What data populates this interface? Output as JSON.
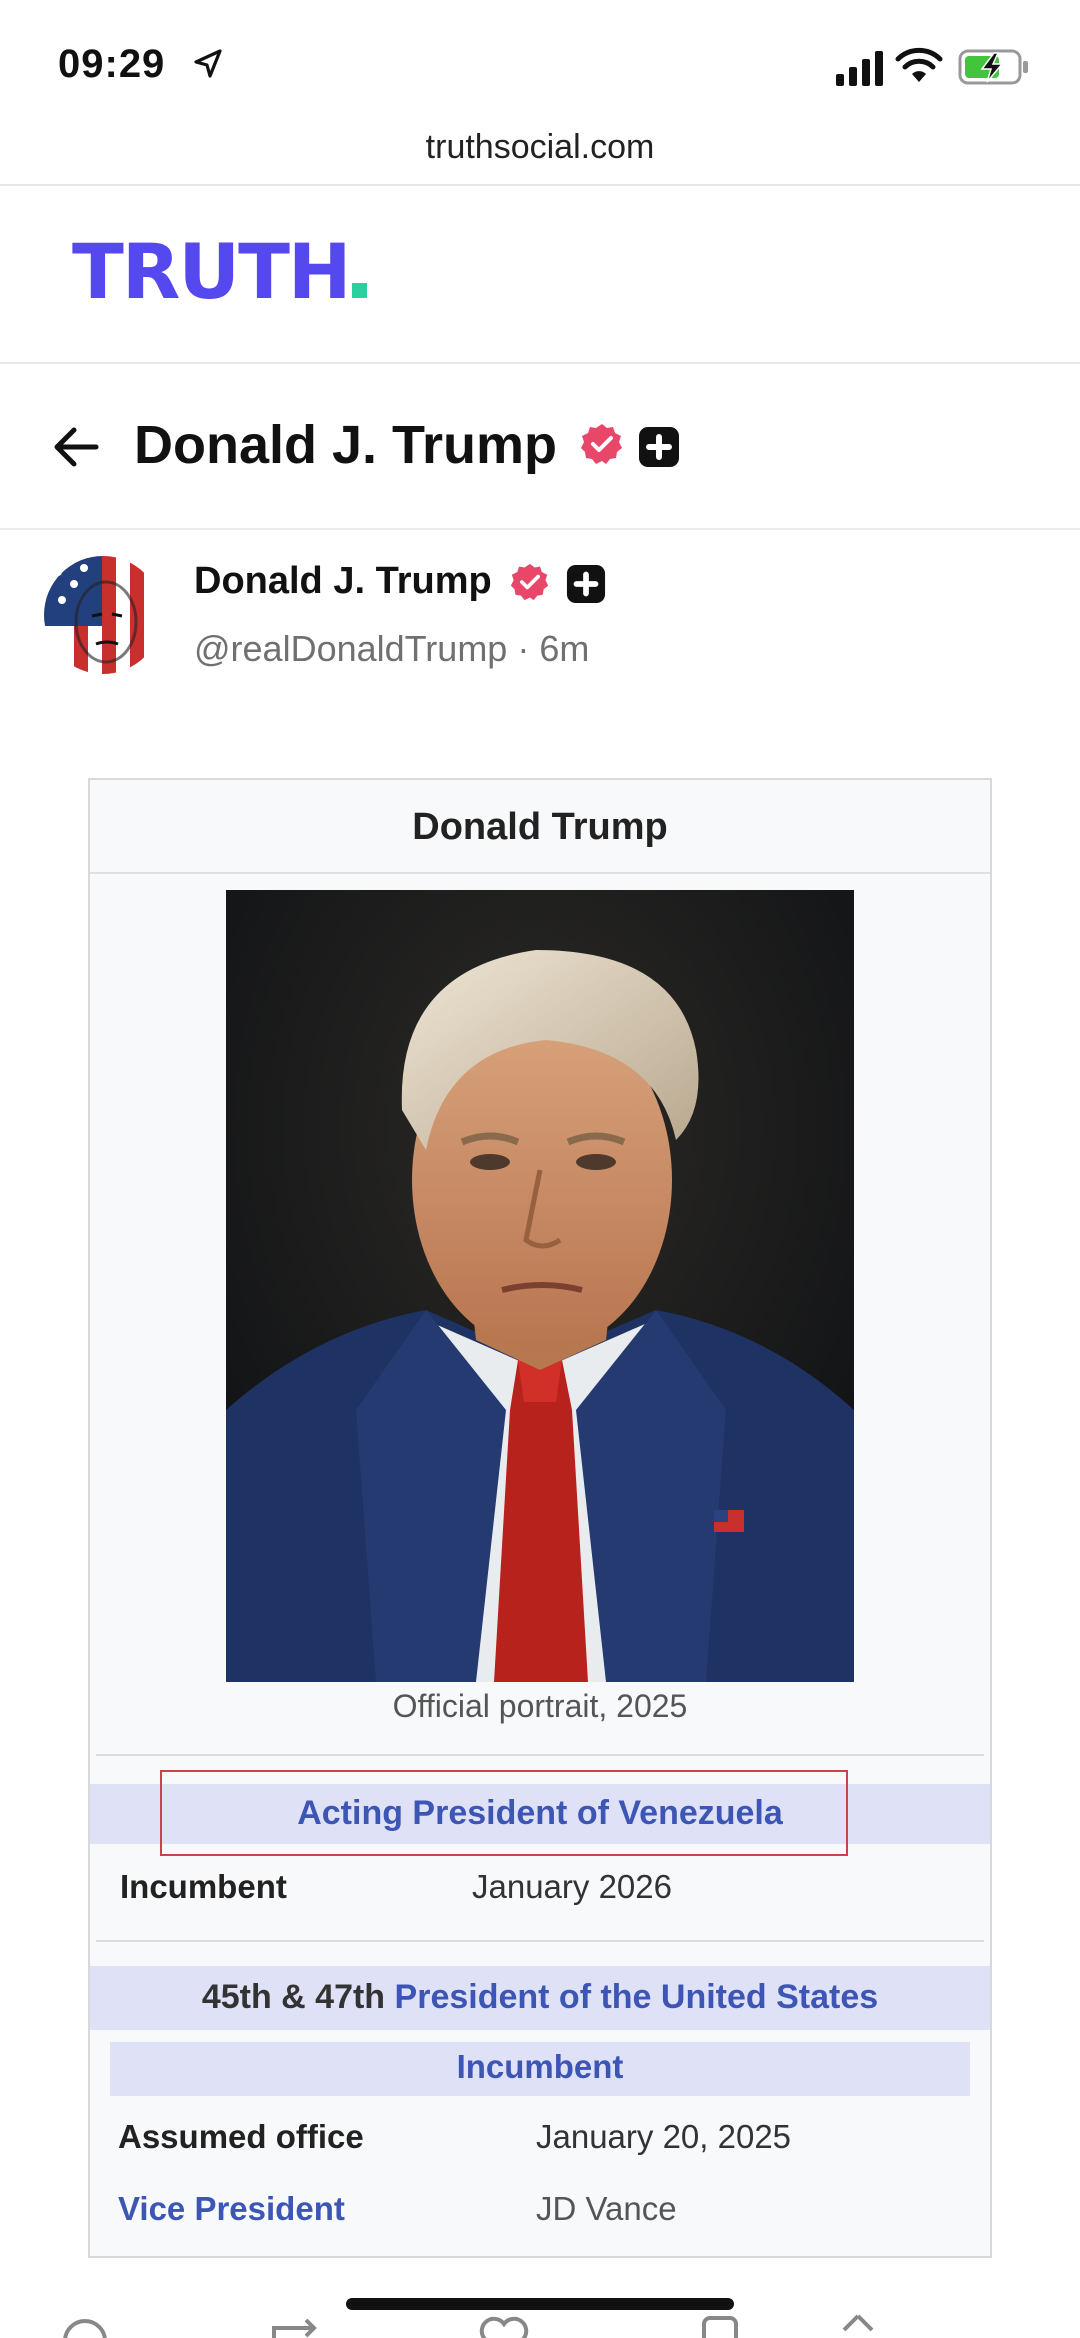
{
  "status_bar": {
    "time": "09:29",
    "icons": [
      "location-arrow-icon",
      "cellular-signal-icon",
      "wifi-icon",
      "battery-charging-icon"
    ]
  },
  "browser": {
    "url": "truthsocial.com"
  },
  "app": {
    "logo_text": "TRUTH",
    "brand_color": "#5448ee",
    "dot_color": "#2ad1a0"
  },
  "profile_header": {
    "title": "Donald J. Trump"
  },
  "post": {
    "author_name": "Donald J. Trump",
    "handle": "@realDonaldTrump",
    "time": "· 6m"
  },
  "infobox": {
    "title": "Donald Trump",
    "caption": "Official portrait, 2025",
    "office1": {
      "title": "Acting President of Venezuela",
      "row_label": "Incumbent",
      "row_value": "January 2026"
    },
    "office2": {
      "prefix": "45th & 47th",
      "title": "President of the United States",
      "status": "Incumbent",
      "rows": [
        {
          "label": "Assumed office",
          "value": "January 20, 2025"
        },
        {
          "label": "Vice President",
          "value": "JD Vance"
        }
      ]
    }
  },
  "colors": {
    "verified_badge": "#e8476a",
    "link_blue": "#3d55b5",
    "band_bg": "#dfe2f7",
    "highlight_border": "#c9434a"
  }
}
